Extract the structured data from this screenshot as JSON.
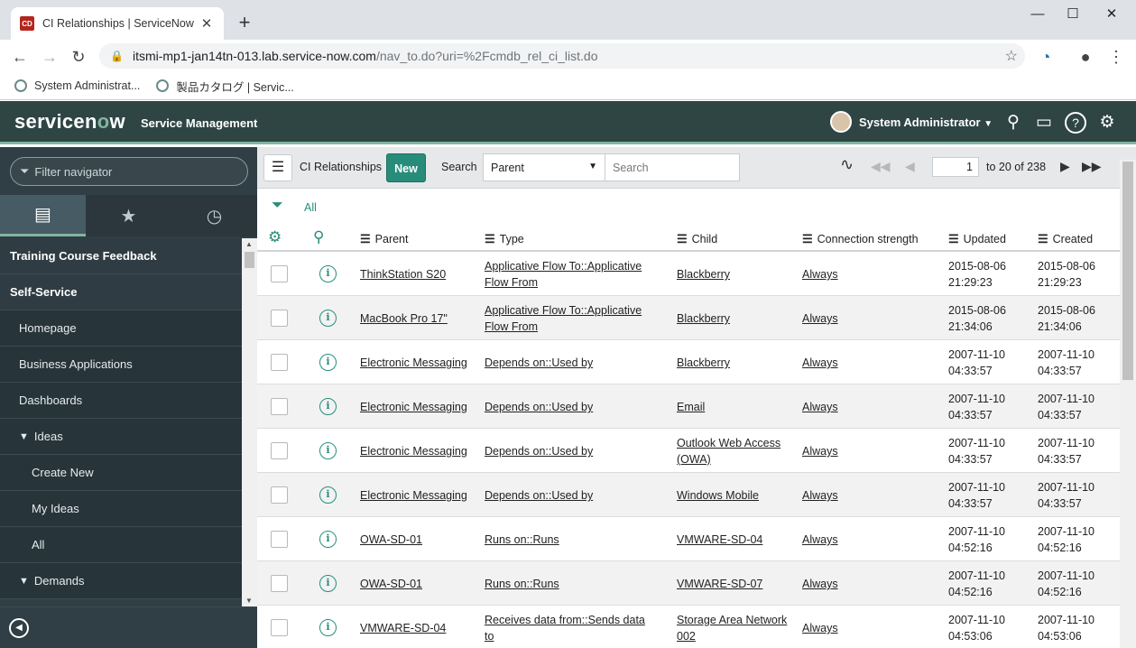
{
  "browser": {
    "tab_title": "CI Relationships | ServiceNow",
    "favicon_text": "CD",
    "url_host": "itsmi-mp1-jan14tn-013.lab.service-now.com",
    "url_path": "/nav_to.do?uri=%2Fcmdb_rel_ci_list.do",
    "bookmarks": [
      "System Administrat...",
      "製品カタログ | Servic..."
    ]
  },
  "header": {
    "logo_a": "servicen",
    "logo_o": "o",
    "logo_b": "w",
    "product": "Service Management",
    "user": "System Administrator"
  },
  "nav": {
    "filter_placeholder": "Filter navigator",
    "items": [
      {
        "label": "Training Course Feedback",
        "level": "mod"
      },
      {
        "label": "Self-Service",
        "level": "mod"
      },
      {
        "label": "Homepage",
        "level": "l1"
      },
      {
        "label": "Business Applications",
        "level": "l1"
      },
      {
        "label": "Dashboards",
        "level": "l1"
      },
      {
        "label": "Ideas",
        "level": "l1",
        "expanded": true
      },
      {
        "label": "Create New",
        "level": "l2"
      },
      {
        "label": "My Ideas",
        "level": "l2"
      },
      {
        "label": "All",
        "level": "l2"
      },
      {
        "label": "Demands",
        "level": "l1",
        "expanded": true
      }
    ]
  },
  "list": {
    "title": "CI Relationships",
    "new_label": "New",
    "search_label": "Search",
    "search_field": "Parent",
    "search_placeholder": "Search",
    "page_value": "1",
    "page_text": "to 20 of 238",
    "filter_label": "All",
    "columns": [
      "Parent",
      "Type",
      "Child",
      "Connection strength",
      "Updated",
      "Created"
    ],
    "rows": [
      {
        "parent": "ThinkStation S20",
        "type": "Applicative Flow To::Applicative Flow From",
        "child": "Blackberry",
        "strength": "Always",
        "updated_d": "2015-08-06",
        "updated_t": "21:29:23",
        "created_d": "2015-08-06",
        "created_t": "21:29:23"
      },
      {
        "parent": "MacBook Pro 17\"",
        "type": "Applicative Flow To::Applicative Flow From",
        "child": "Blackberry",
        "strength": "Always",
        "updated_d": "2015-08-06",
        "updated_t": "21:34:06",
        "created_d": "2015-08-06",
        "created_t": "21:34:06"
      },
      {
        "parent": "Electronic Messaging",
        "type": "Depends on::Used by",
        "child": "Blackberry",
        "strength": "Always",
        "updated_d": "2007-11-10",
        "updated_t": "04:33:57",
        "created_d": "2007-11-10",
        "created_t": "04:33:57"
      },
      {
        "parent": "Electronic Messaging",
        "type": "Depends on::Used by",
        "child": "Email",
        "strength": "Always",
        "updated_d": "2007-11-10",
        "updated_t": "04:33:57",
        "created_d": "2007-11-10",
        "created_t": "04:33:57"
      },
      {
        "parent": "Electronic Messaging",
        "type": "Depends on::Used by",
        "child": "Outlook Web Access (OWA)",
        "strength": "Always",
        "updated_d": "2007-11-10",
        "updated_t": "04:33:57",
        "created_d": "2007-11-10",
        "created_t": "04:33:57"
      },
      {
        "parent": "Electronic Messaging",
        "type": "Depends on::Used by",
        "child": "Windows Mobile",
        "strength": "Always",
        "updated_d": "2007-11-10",
        "updated_t": "04:33:57",
        "created_d": "2007-11-10",
        "created_t": "04:33:57"
      },
      {
        "parent": "OWA-SD-01",
        "type": "Runs on::Runs",
        "child": "VMWARE-SD-04",
        "strength": "Always",
        "updated_d": "2007-11-10",
        "updated_t": "04:52:16",
        "created_d": "2007-11-10",
        "created_t": "04:52:16"
      },
      {
        "parent": "OWA-SD-01",
        "type": "Runs on::Runs",
        "child": "VMWARE-SD-07",
        "strength": "Always",
        "updated_d": "2007-11-10",
        "updated_t": "04:52:16",
        "created_d": "2007-11-10",
        "created_t": "04:52:16"
      },
      {
        "parent": "VMWARE-SD-04",
        "type": "Receives data from::Sends data to",
        "child": "Storage Area Network 002",
        "strength": "Always",
        "updated_d": "2007-11-10",
        "updated_t": "04:53:06",
        "created_d": "2007-11-10",
        "created_t": "04:53:06"
      }
    ]
  },
  "colors": {
    "header": "#2e4544",
    "accent": "#81b5a1",
    "button": "#278d7a",
    "nav": "#303e45"
  }
}
